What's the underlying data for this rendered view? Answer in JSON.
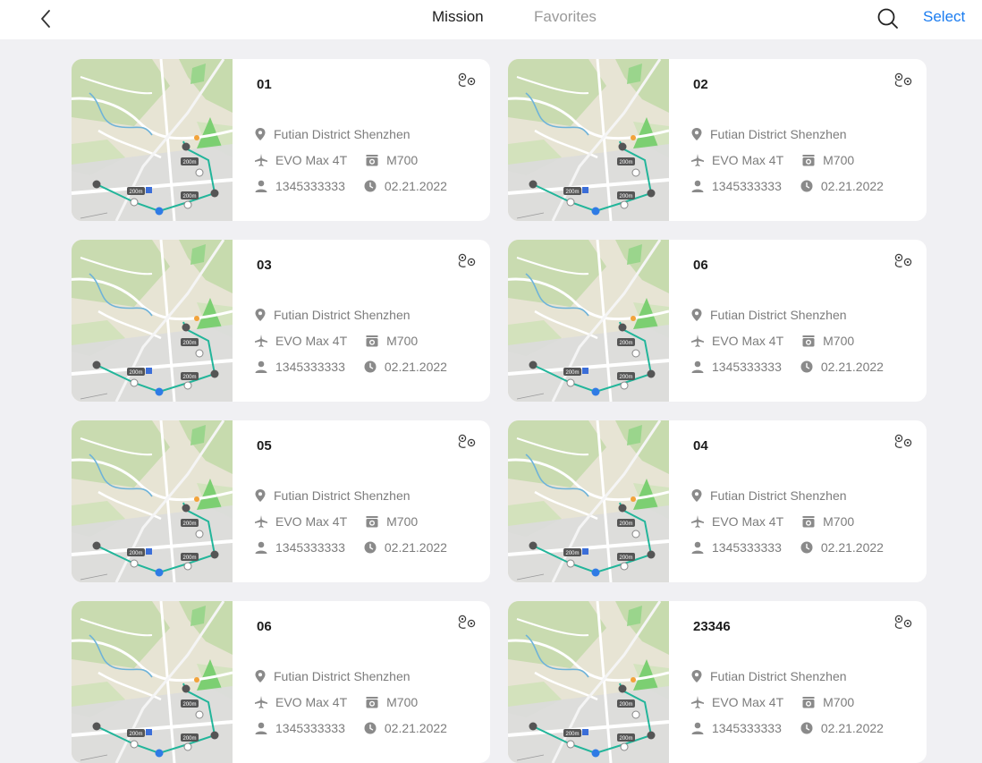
{
  "header": {
    "tabs": [
      {
        "label": "Mission",
        "active": true
      },
      {
        "label": "Favorites",
        "active": false
      }
    ],
    "select_label": "Select",
    "icons": {
      "back": "chevron-left-icon",
      "search": "search-icon"
    },
    "accent_color": "#1a7cf0"
  },
  "missions": [
    {
      "name": "01",
      "location": "Futian District Shenzhen",
      "aircraft": "EVO Max 4T",
      "camera": "M700",
      "user": "1345333333",
      "date": "02.21.2022"
    },
    {
      "name": "02",
      "location": "Futian District Shenzhen",
      "aircraft": "EVO Max 4T",
      "camera": "M700",
      "user": "1345333333",
      "date": "02.21.2022"
    },
    {
      "name": "03",
      "location": "Futian District Shenzhen",
      "aircraft": "EVO Max 4T",
      "camera": "M700",
      "user": "1345333333",
      "date": "02.21.2022"
    },
    {
      "name": "06",
      "location": "Futian District Shenzhen",
      "aircraft": "EVO Max 4T",
      "camera": "M700",
      "user": "1345333333",
      "date": "02.21.2022"
    },
    {
      "name": "05",
      "location": "Futian District Shenzhen",
      "aircraft": "EVO Max 4T",
      "camera": "M700",
      "user": "1345333333",
      "date": "02.21.2022"
    },
    {
      "name": "04",
      "location": "Futian District Shenzhen",
      "aircraft": "EVO Max 4T",
      "camera": "M700",
      "user": "1345333333",
      "date": "02.21.2022"
    },
    {
      "name": "06",
      "location": "Futian District Shenzhen",
      "aircraft": "EVO Max 4T",
      "camera": "M700",
      "user": "1345333333",
      "date": "02.21.2022"
    },
    {
      "name": "23346",
      "location": "Futian District Shenzhen",
      "aircraft": "EVO Max 4T",
      "camera": "M700",
      "user": "1345333333",
      "date": "02.21.2022"
    }
  ],
  "map_thumbnail": {
    "route_labels": [
      "200m",
      "200m",
      "200m"
    ],
    "route_color": "#22b59a"
  }
}
